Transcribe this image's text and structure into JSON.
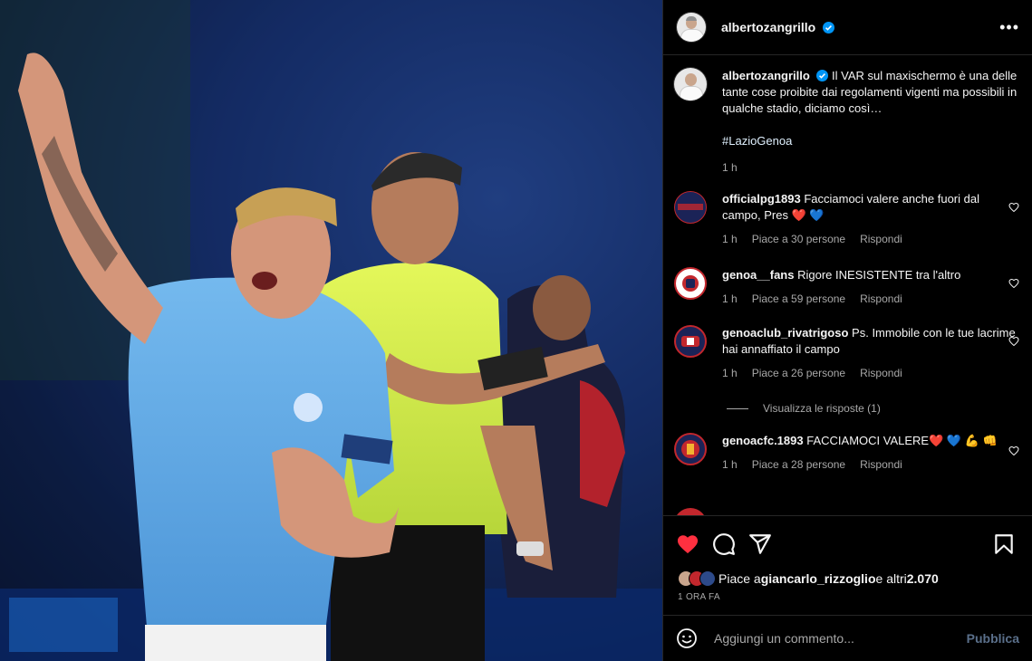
{
  "post": {
    "author": "albertozangrillo",
    "caption_text": "Il VAR sul maxischermo è una delle tante cose proibite dai regolamenti vigenti ma possibili in qualche stadio, diciamo così…",
    "hashtag": "#LazioGenoa",
    "caption_time": "1 h"
  },
  "comments": [
    {
      "user": "officialpg1893",
      "text": "Facciamoci valere anche fuori dal campo, Pres ❤️ 💙",
      "time": "1 h",
      "likes": "Piace a 30 persone",
      "reply": "Rispondi"
    },
    {
      "user": "genoa__fans",
      "text": "Rigore INESISTENTE tra l'altro",
      "time": "1 h",
      "likes": "Piace a 59 persone",
      "reply": "Rispondi"
    },
    {
      "user": "genoaclub_rivatrigoso",
      "text": "Ps. Immobile con le tue lacrime hai annaffiato il campo",
      "time": "1 h",
      "likes": "Piace a 26 persone",
      "reply": "Rispondi"
    },
    {
      "user": "genoacfc.1893",
      "text": "FACCIAMOCI VALERE❤️ 💙 💪 👊",
      "time": "1 h",
      "likes": "Piace a 28 persone",
      "reply": "Rispondi"
    }
  ],
  "view_replies": "Visualizza le risposte (1)",
  "likes_line": {
    "prefix": "Piace a ",
    "user": "giancarlo_rizzoglio",
    "suffix": " e altri ",
    "count": "2.070"
  },
  "post_time": "1 ORA FA",
  "add_comment": {
    "placeholder": "Aggiungi un commento...",
    "publish": "Pubblica"
  },
  "colors": {
    "like_red": "#ff3040",
    "verified_blue": "#0095f6",
    "lazio_blue": "#5aa9e6",
    "referee_yellow": "#d8f24a"
  },
  "icons": [
    "more-icon",
    "heart-icon",
    "comment-icon",
    "share-icon",
    "bookmark-icon",
    "emoji-icon",
    "verified-icon"
  ]
}
